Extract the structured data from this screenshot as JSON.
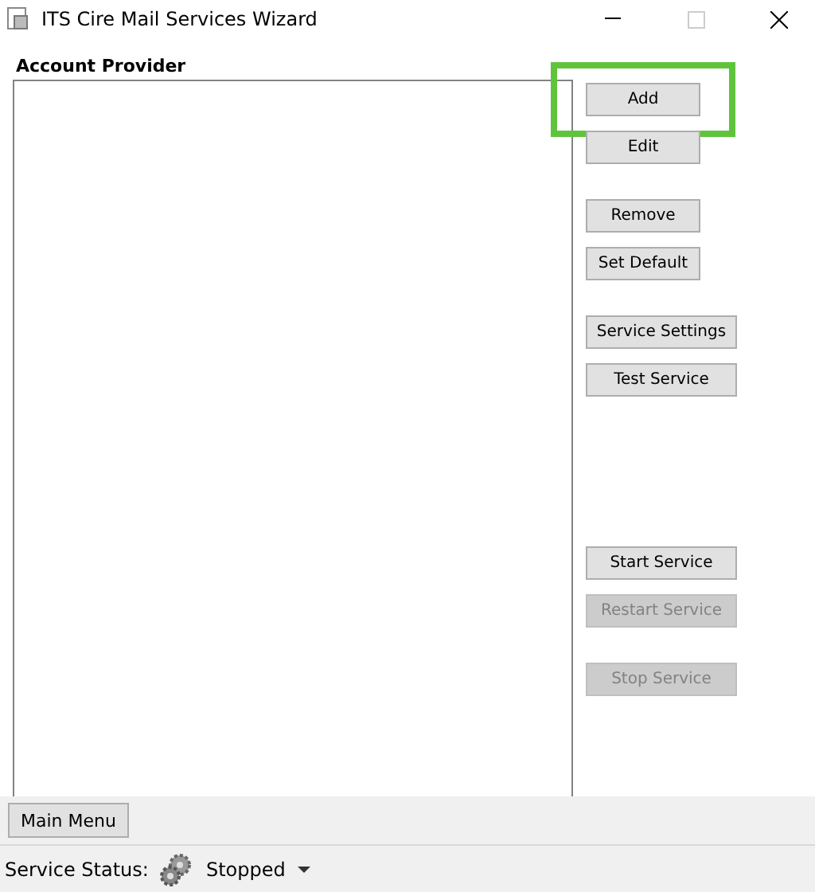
{
  "window": {
    "title": "ITS Cire Mail Services Wizard"
  },
  "section_label": "Account Provider",
  "button_groups": [
    [
      {
        "label": "Add",
        "disabled": false,
        "highlighted": true
      },
      {
        "label": "Edit",
        "disabled": false,
        "highlighted": false
      }
    ],
    [
      {
        "label": "Remove",
        "disabled": false,
        "highlighted": false
      },
      {
        "label": "Set Default",
        "disabled": false,
        "highlighted": false
      }
    ],
    [
      {
        "label": "Service Settings",
        "disabled": false,
        "highlighted": false
      },
      {
        "label": "Test Service",
        "disabled": false,
        "highlighted": false
      }
    ],
    [
      {
        "label": "Start Service",
        "disabled": false,
        "highlighted": false
      },
      {
        "label": "Restart Service",
        "disabled": true,
        "highlighted": false
      }
    ],
    [
      {
        "label": "Stop Service",
        "disabled": true,
        "highlighted": false
      }
    ]
  ],
  "main_menu_button": "Main Menu",
  "status_bar": {
    "label": "Service Status:",
    "value": "Stopped"
  }
}
